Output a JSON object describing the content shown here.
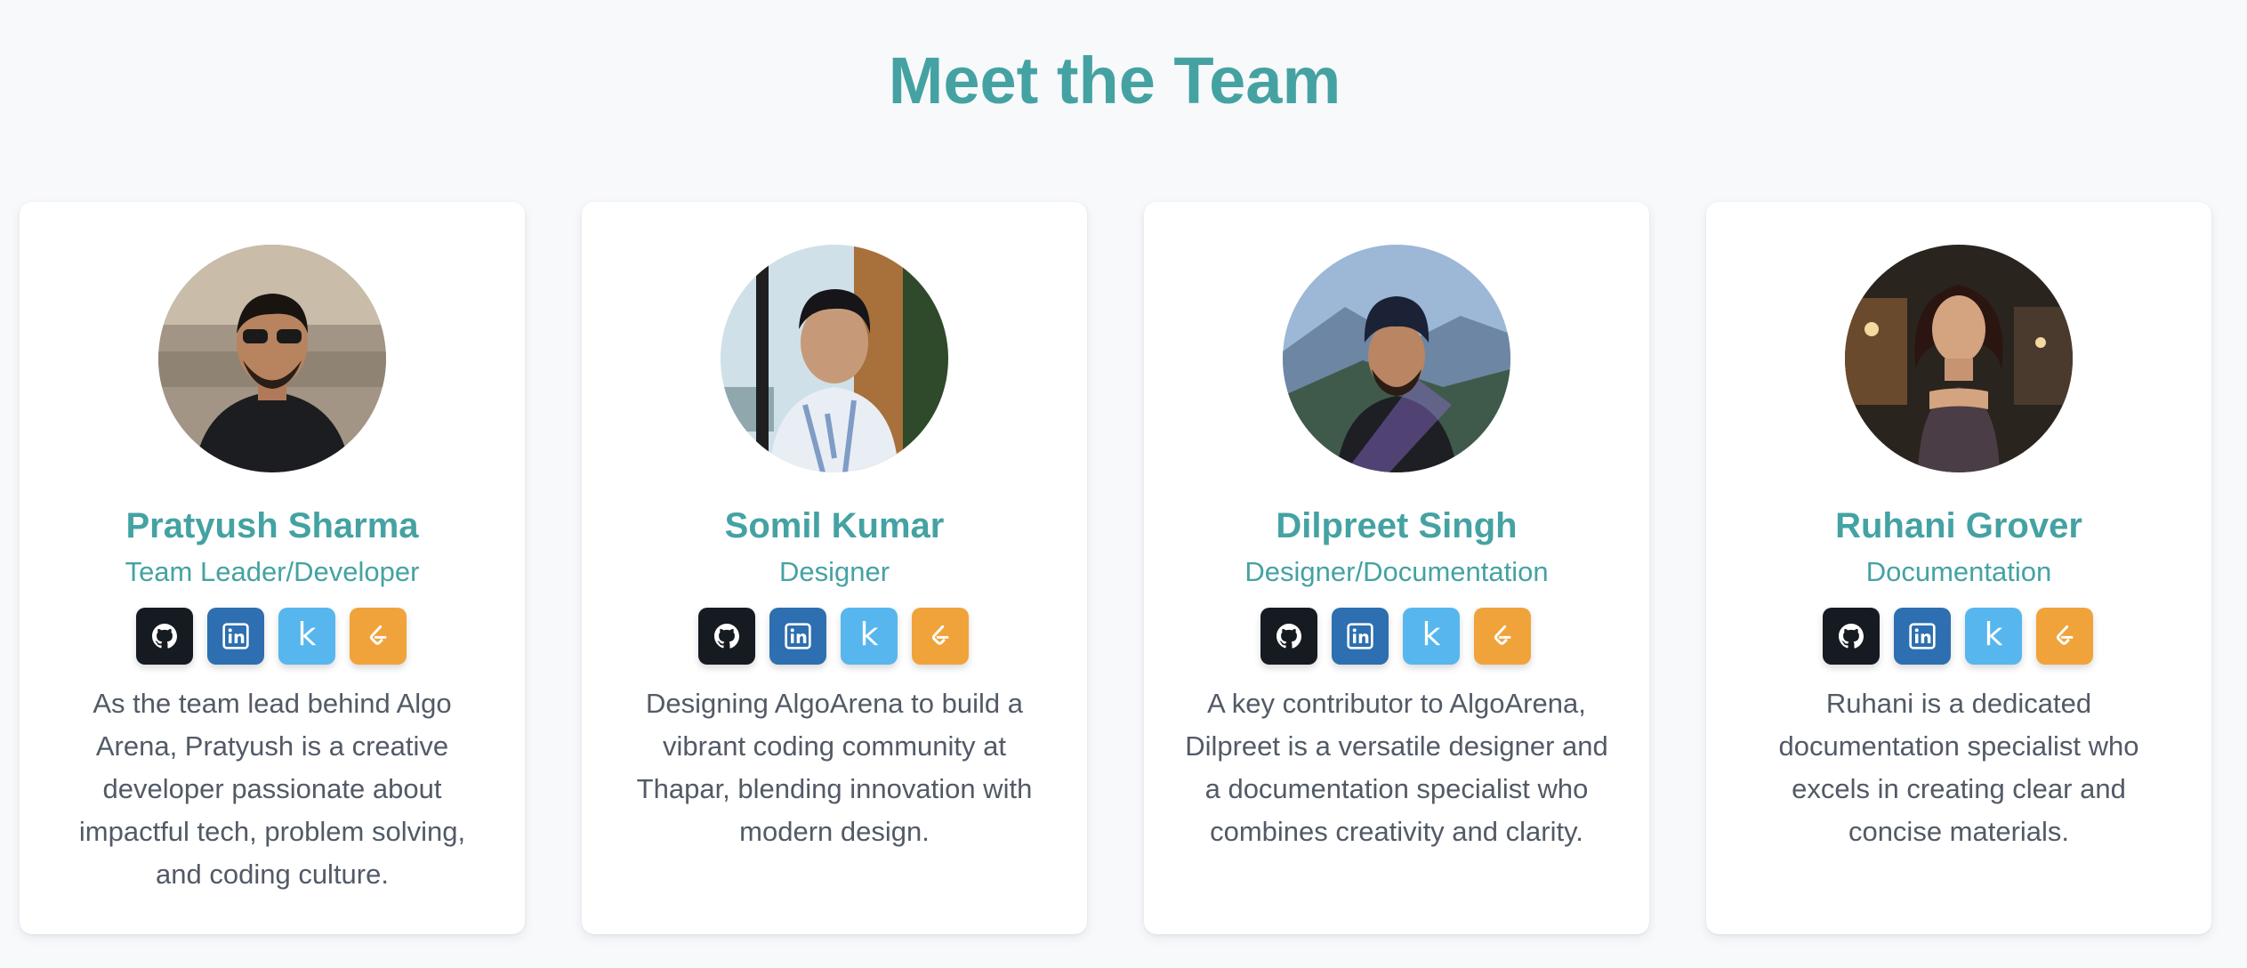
{
  "title": "Meet the Team",
  "members": [
    {
      "name": "Pratyush Sharma",
      "role": "Team Leader/Developer",
      "description": "As the team lead behind Algo Arena, Pratyush is a creative developer passionate about impactful tech, problem solving, and coding culture."
    },
    {
      "name": "Somil Kumar",
      "role": "Designer",
      "description": "Designing AlgoArena to build a vibrant coding community at Thapar, blending innovation with modern design."
    },
    {
      "name": "Dilpreet Singh",
      "role": "Designer/Documentation",
      "description": "A key contributor to AlgoArena, Dilpreet is a versatile designer and a documentation specialist who combines creativity and clarity."
    },
    {
      "name": "Ruhani Grover",
      "role": "Documentation",
      "description": "Ruhani is a dedicated documentation specialist who excels in creating clear and concise materials."
    }
  ],
  "social_icons": [
    "github-icon",
    "linkedin-icon",
    "kaggle-icon",
    "leetcode-icon"
  ],
  "kaggle_letter": "k",
  "colors": {
    "accent": "#45a2a3",
    "background": "#f8f9fb",
    "github": "#161b22",
    "linkedin": "#2d6fb0",
    "kaggle": "#57b6ee",
    "leetcode": "#f0a33a",
    "text": "#525a66"
  }
}
